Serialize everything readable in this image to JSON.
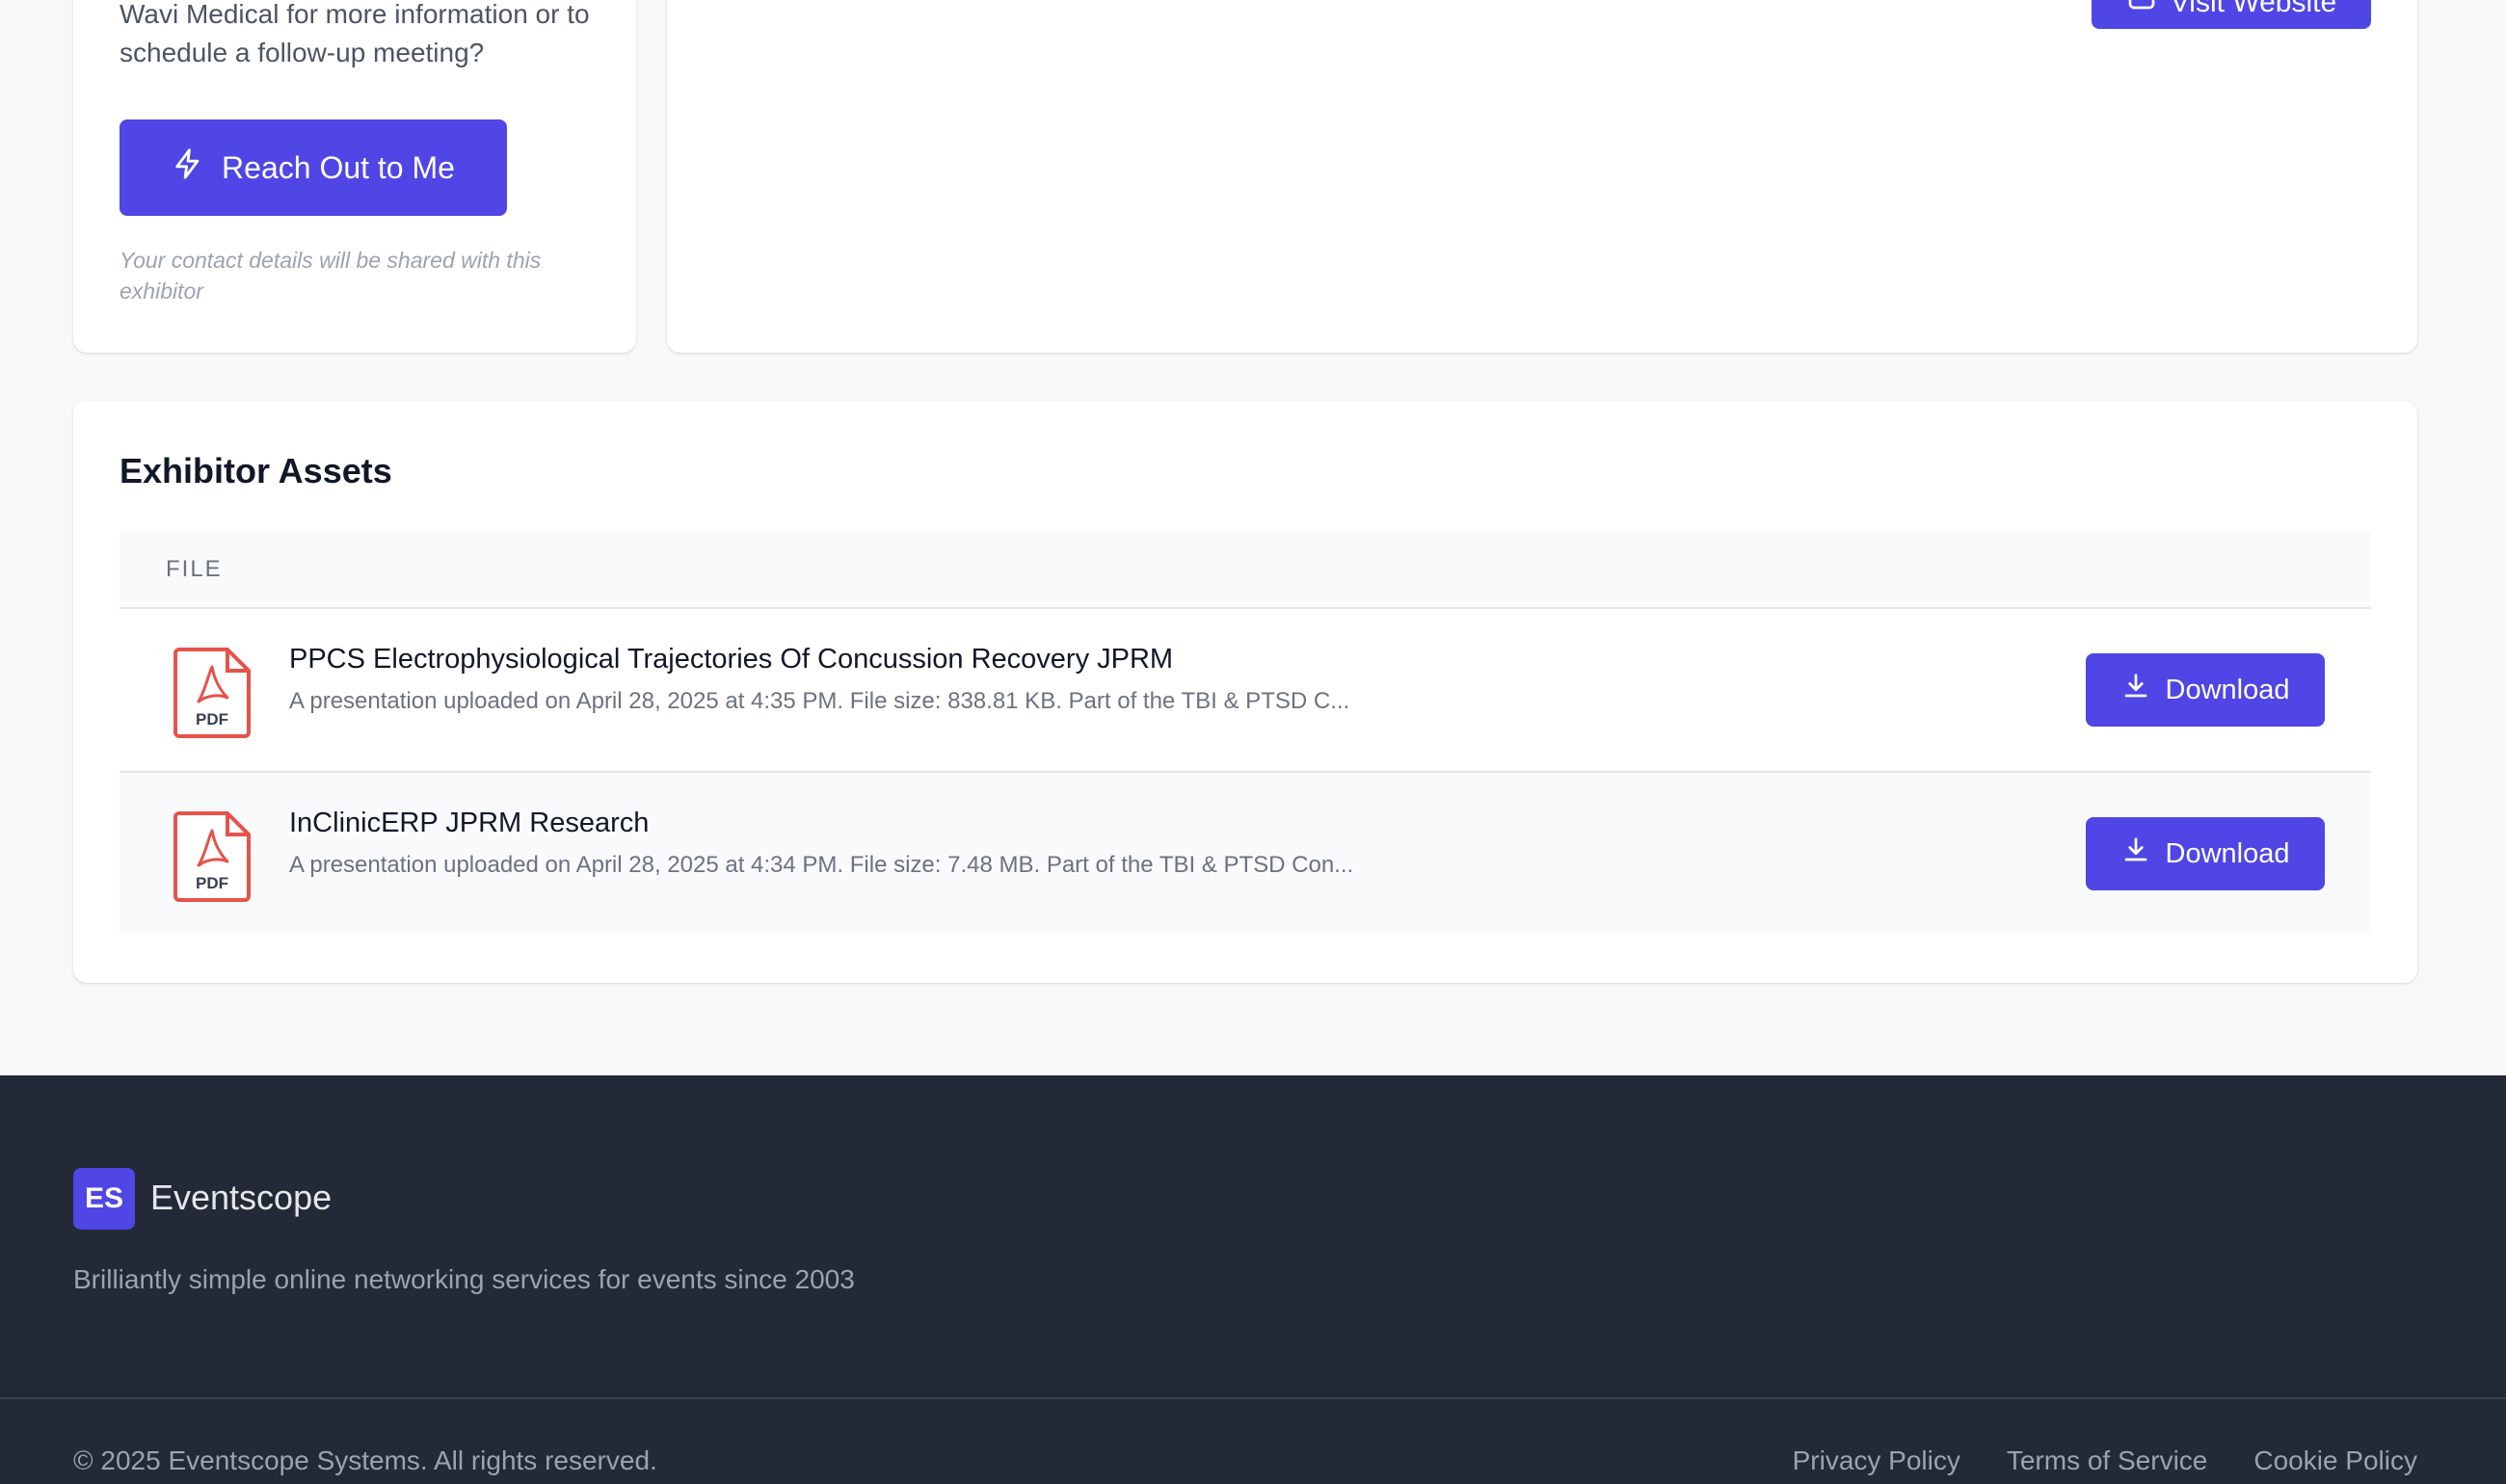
{
  "contact": {
    "text": "Wavi Medical for more information or to schedule a follow-up meeting?",
    "button_label": "Reach Out to Me",
    "note": "Your contact details will be shared with this exhibitor"
  },
  "about": {
    "visit_button_label": "Visit Website"
  },
  "assets": {
    "title": "Exhibitor Assets",
    "column_header": "FILE",
    "rows": [
      {
        "icon": "pdf-file-icon",
        "title": "PPCS Electrophysiological Trajectories Of Concussion Recovery JPRM",
        "description": "A presentation uploaded on April 28, 2025 at 4:35 PM. File size: 838.81 KB. Part of the TBI & PTSD C...",
        "button_label": "Download"
      },
      {
        "icon": "pdf-file-icon",
        "title": "InClinicERP JPRM Research",
        "description": "A presentation uploaded on April 28, 2025 at 4:34 PM. File size: 7.48 MB. Part of the TBI & PTSD Con...",
        "button_label": "Download"
      }
    ],
    "pdf_label": "PDF"
  },
  "footer": {
    "logo_initials": "ES",
    "brand": "Eventscope",
    "tagline": "Brilliantly simple online networking services for events since 2003",
    "copyright": "© 2025 Eventscope Systems. All rights reserved.",
    "links": [
      "Privacy Policy",
      "Terms of Service",
      "Cookie Policy"
    ]
  },
  "colors": {
    "accent": "#4f46e5",
    "footer_bg": "#232937",
    "page_bg": "#f7f8fa",
    "pdf_red": "#e5534b"
  }
}
